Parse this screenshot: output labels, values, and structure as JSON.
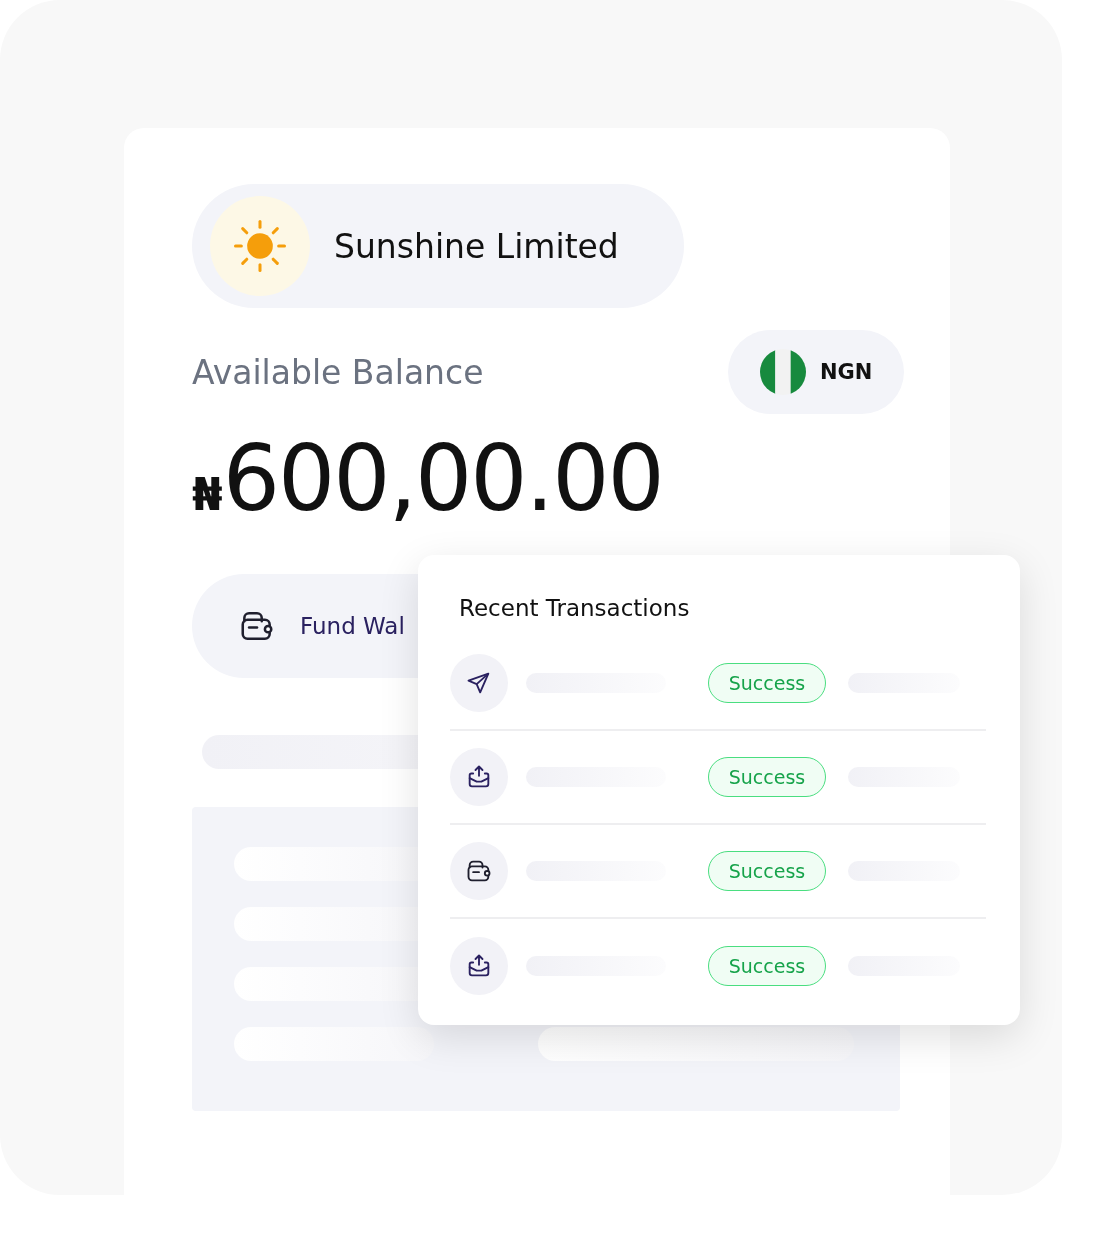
{
  "account": {
    "name": "Sunshine Limited"
  },
  "balance": {
    "label": "Available Balance",
    "currency_symbol": "₦",
    "amount": "600,00.00",
    "currency": "NGN"
  },
  "fund_button": {
    "label": "Fund Wal"
  },
  "recent_transactions": {
    "title": "Recent Transactions",
    "rows": [
      {
        "kind": "send",
        "status": "Success"
      },
      {
        "kind": "upload",
        "status": "Success"
      },
      {
        "kind": "wallet",
        "status": "Success"
      },
      {
        "kind": "upload",
        "status": "Success"
      }
    ]
  }
}
